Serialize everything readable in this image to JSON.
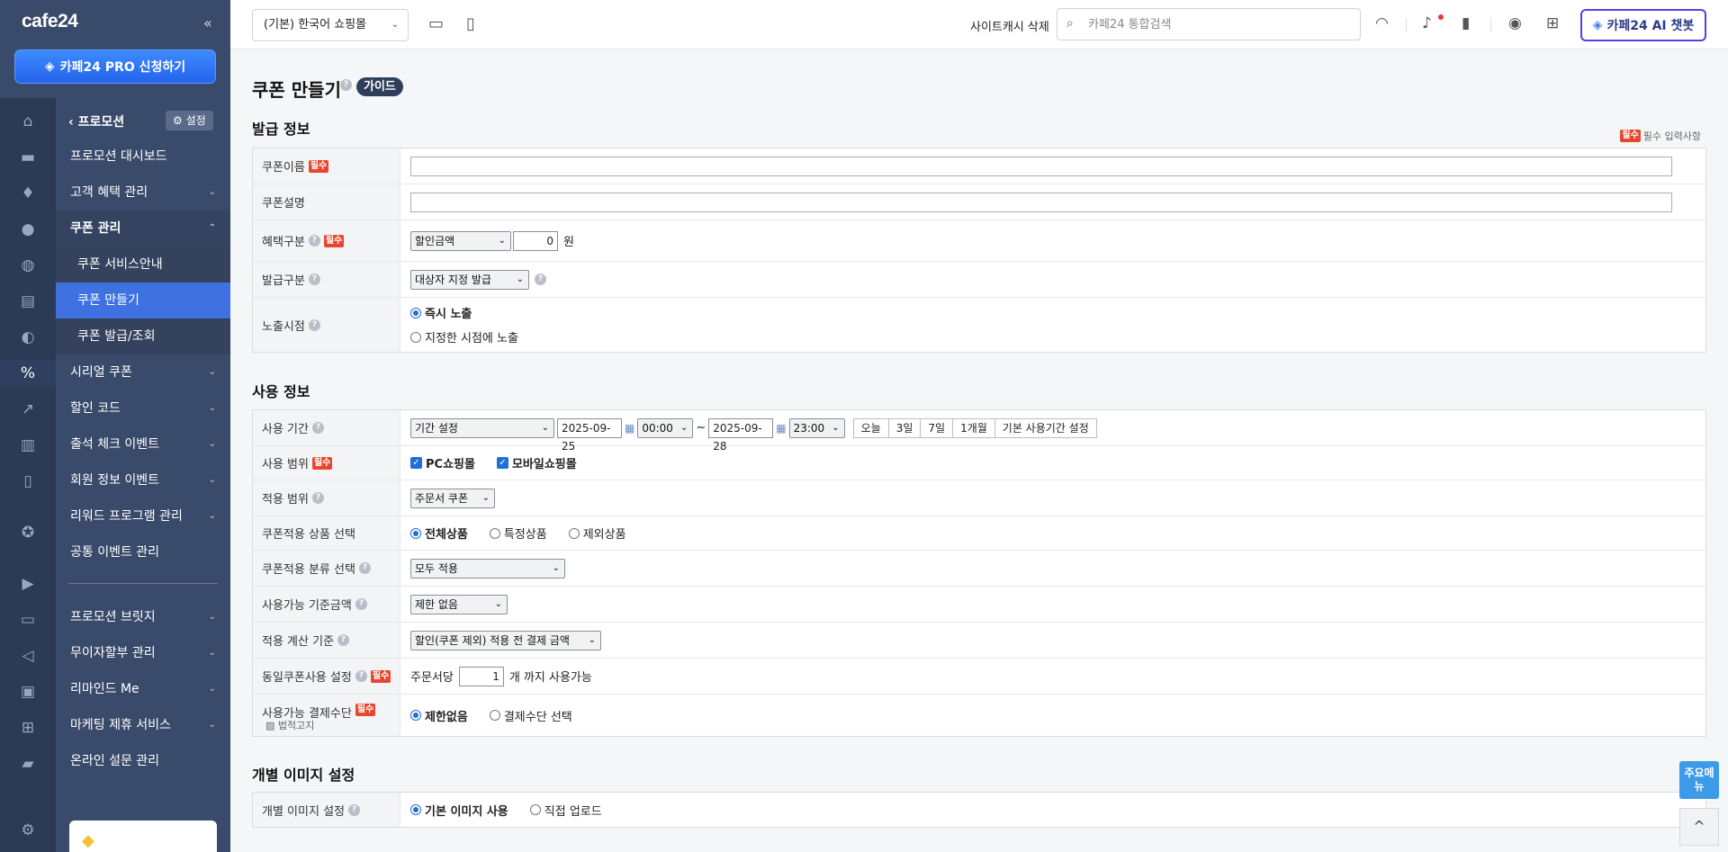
{
  "sidebar": {
    "logo": "cafe24",
    "collapse": "«",
    "pro_button": "카페24 PRO 신청하기",
    "back_label": "프로모션",
    "settings_label": "설정",
    "items": [
      {
        "label": "프로모션 대시보드"
      },
      {
        "label": "고객 혜택 관리"
      },
      {
        "label": "쿠폰 관리"
      },
      {
        "label": "쿠폰 서비스안내"
      },
      {
        "label": "쿠폰 만들기"
      },
      {
        "label": "쿠폰 발급/조회"
      },
      {
        "label": "시리얼 쿠폰"
      },
      {
        "label": "할인 코드"
      },
      {
        "label": "출석 체크 이벤트"
      },
      {
        "label": "회원 정보 이벤트"
      },
      {
        "label": "리워드 프로그램 관리"
      },
      {
        "label": "공통 이벤트 관리"
      },
      {
        "label": "프로모션 브릿지"
      },
      {
        "label": "무이자할부 관리"
      },
      {
        "label": "리마인드 Me"
      },
      {
        "label": "마케팅 제휴 서비스"
      },
      {
        "label": "온라인 설문 관리"
      }
    ]
  },
  "topbar": {
    "mall_select": "(기본) 한국어 쇼핑몰",
    "cache_delete": "사이트캐시 삭제",
    "search_placeholder": "카페24 통합검색",
    "ai_button": "카페24 AI 챗봇"
  },
  "page": {
    "title": "쿠폰 만들기",
    "guide": "가이드",
    "required_badge": "필수",
    "required_note": "필수 입력사항"
  },
  "issue_section": {
    "title": "발급 정보",
    "coupon_name_label": "쿠폰이름",
    "coupon_desc_label": "쿠폰설명",
    "benefit_label": "혜택구분",
    "benefit_select": "할인금액",
    "benefit_value": "0",
    "benefit_unit": "원",
    "issue_type_label": "발급구분",
    "issue_type_select": "대상자 지정 발급",
    "display_label": "노출시점",
    "display_opt1": "즉시 노출",
    "display_opt2": "지정한 시점에 노출"
  },
  "usage_section": {
    "title": "사용 정보",
    "period_label": "사용 기간",
    "period_select": "기간 설정",
    "start_date": "2025-09-25",
    "start_time": "00:00",
    "tilde": "~",
    "end_date": "2025-09-28",
    "end_time": "23:00",
    "quick_periods": [
      "오늘",
      "3일",
      "7일",
      "1개월",
      "기본 사용기간 설정"
    ],
    "scope_label": "사용 범위",
    "scope_pc": "PC쇼핑몰",
    "scope_mobile": "모바일쇼핑몰",
    "apply_label": "적용 범위",
    "apply_select": "주문서 쿠폰",
    "product_label": "쿠폰적용 상품 선택",
    "product_opt1": "전체상품",
    "product_opt2": "특정상품",
    "product_opt3": "제외상품",
    "category_label": "쿠폰적용 분류 선택",
    "category_select": "모두 적용",
    "min_amount_label": "사용가능 기준금액",
    "min_amount_select": "제한 없음",
    "calc_label": "적용 계산 기준",
    "calc_select": "할인(쿠폰 제외) 적용 전 결제 금액",
    "same_label": "동일쿠폰사용 설정",
    "same_prefix": "주문서당",
    "same_value": "1",
    "same_suffix": "개 까지 사용가능",
    "payment_label": "사용가능 결제수단",
    "legal_note": "법적고지",
    "payment_opt1": "제한없음",
    "payment_opt2": "결제수단 선택"
  },
  "image_section": {
    "title": "개별 이미지 설정",
    "label": "개별 이미지 설정",
    "opt1": "기본 이미지 사용",
    "opt2": "직접 업로드"
  },
  "floating": {
    "quick_menu": "주요메뉴",
    "to_top": "^"
  }
}
